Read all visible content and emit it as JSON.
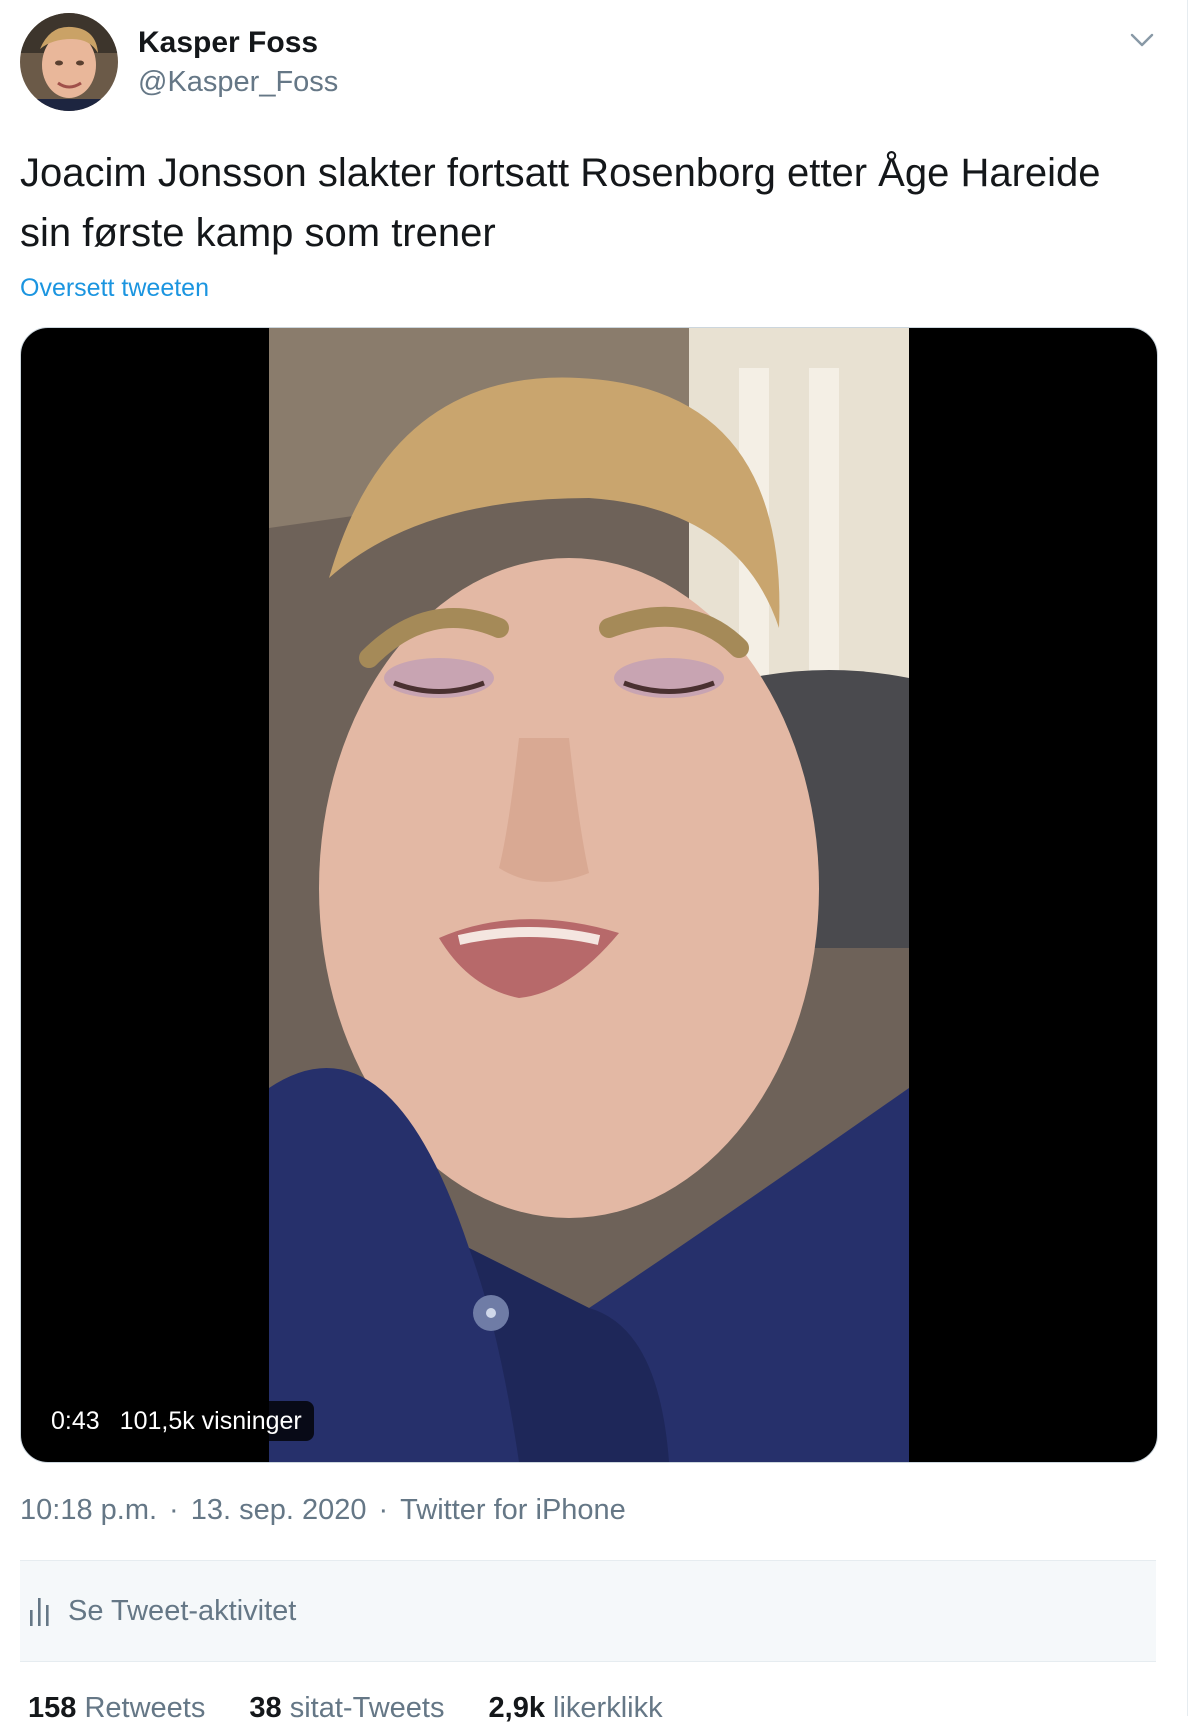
{
  "author": {
    "name": "Kasper Foss",
    "handle": "@Kasper_Foss"
  },
  "tweet": {
    "text": "Joacim Jonsson slakter fortsatt Rosenborg etter Åge Hareide sin første kamp som trener",
    "translate_label": "Oversett tweeten"
  },
  "video": {
    "duration": "0:43",
    "views": "101,5k visninger"
  },
  "meta": {
    "time": "10:18 p.m.",
    "date": "13. sep. 2020",
    "source": "Twitter for iPhone",
    "separator": "·"
  },
  "activity": {
    "label": "Se Tweet-aktivitet"
  },
  "stats": {
    "retweets_count": "158",
    "retweets_label": "Retweets",
    "quotes_count": "38",
    "quotes_label": "sitat-Tweets",
    "likes_count": "2,9k",
    "likes_label": "likerklikk"
  },
  "icons": {
    "menu": "chevron-down-icon",
    "activity": "bar-chart-icon"
  },
  "colors": {
    "link": "#1b95e0",
    "muted": "#657786",
    "text": "#14171a",
    "shirt": "#26306b"
  }
}
